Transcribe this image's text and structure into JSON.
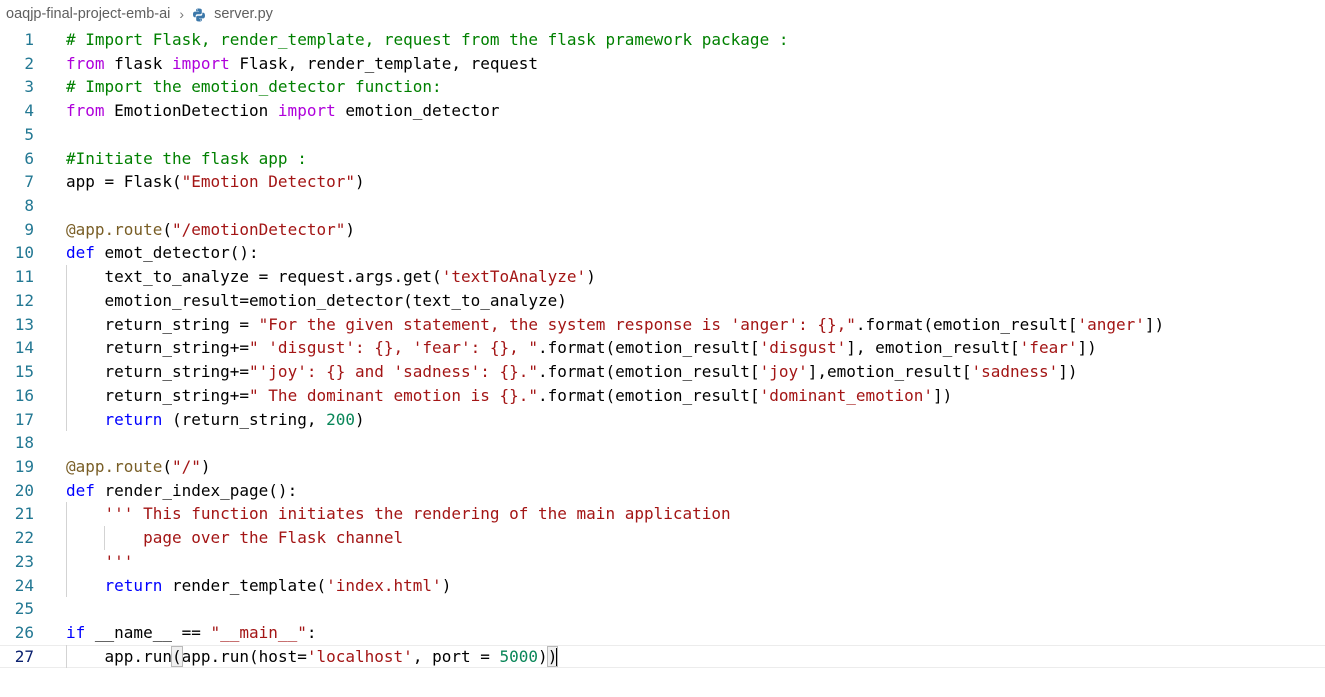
{
  "breadcrumb": {
    "folder": "oaqjp-final-project-emb-ai",
    "file": "server.py",
    "file_icon": "python-icon"
  },
  "editor": {
    "language": "python",
    "current_line": 27,
    "lines": [
      {
        "n": "1",
        "text": "# Import Flask, render_template, request from the flask pramework package : "
      },
      {
        "n": "2",
        "text": "from flask import Flask, render_template, request"
      },
      {
        "n": "3",
        "text": "# Import the emotion_detector function:"
      },
      {
        "n": "4",
        "text": "from EmotionDetection import emotion_detector"
      },
      {
        "n": "5",
        "text": ""
      },
      {
        "n": "6",
        "text": "#Initiate the flask app :"
      },
      {
        "n": "7",
        "text": "app = Flask(\"Emotion Detector\")"
      },
      {
        "n": "8",
        "text": ""
      },
      {
        "n": "9",
        "text": "@app.route(\"/emotionDetector\")"
      },
      {
        "n": "10",
        "text": "def emot_detector():"
      },
      {
        "n": "11",
        "text": "    text_to_analyze = request.args.get('textToAnalyze')"
      },
      {
        "n": "12",
        "text": "    emotion_result=emotion_detector(text_to_analyze)"
      },
      {
        "n": "13",
        "text": "    return_string = \"For the given statement, the system response is 'anger': {},\".format(emotion_result['anger'])"
      },
      {
        "n": "14",
        "text": "    return_string+=\" 'disgust': {}, 'fear': {}, \".format(emotion_result['disgust'], emotion_result['fear'])"
      },
      {
        "n": "15",
        "text": "    return_string+=\"'joy': {} and 'sadness': {}.\".format(emotion_result['joy'],emotion_result['sadness'])"
      },
      {
        "n": "16",
        "text": "    return_string+=\" The dominant emotion is {}.\".format(emotion_result['dominant_emotion'])"
      },
      {
        "n": "17",
        "text": "    return (return_string, 200)"
      },
      {
        "n": "18",
        "text": ""
      },
      {
        "n": "19",
        "text": "@app.route(\"/\")"
      },
      {
        "n": "20",
        "text": "def render_index_page():"
      },
      {
        "n": "21",
        "text": "    ''' This function initiates the rendering of the main application"
      },
      {
        "n": "22",
        "text": "        page over the Flask channel"
      },
      {
        "n": "23",
        "text": "    '''"
      },
      {
        "n": "24",
        "text": "    return render_template('index.html')"
      },
      {
        "n": "25",
        "text": ""
      },
      {
        "n": "26",
        "text": "if __name__ == \"__main__\":"
      },
      {
        "n": "27",
        "text": "    app.run(app.run(host='localhost', port = 5000))"
      }
    ]
  }
}
